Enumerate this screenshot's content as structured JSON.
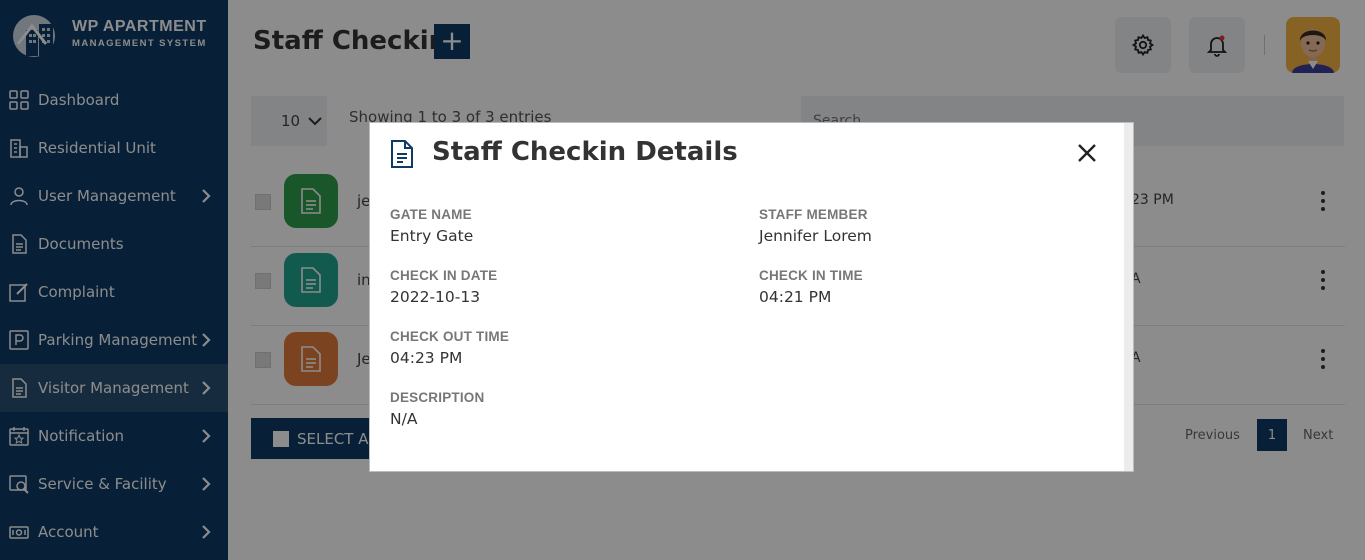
{
  "brand": {
    "title": "WP APARTMENT",
    "subtitle": "MANAGEMENT SYSTEM"
  },
  "sidebar": {
    "items": [
      {
        "label": "Dashboard",
        "icon": "grid-icon",
        "has_submenu": false
      },
      {
        "label": "Residential Unit",
        "icon": "building-icon",
        "has_submenu": false
      },
      {
        "label": "User Management",
        "icon": "user-icon",
        "has_submenu": true
      },
      {
        "label": "Documents",
        "icon": "document-icon",
        "has_submenu": false
      },
      {
        "label": "Complaint",
        "icon": "edit-icon",
        "has_submenu": false
      },
      {
        "label": "Parking Management",
        "icon": "parking-icon",
        "has_submenu": true
      },
      {
        "label": "Visitor Management",
        "icon": "visitor-icon",
        "has_submenu": true,
        "active": true
      },
      {
        "label": "Notification",
        "icon": "calendar-star-icon",
        "has_submenu": true
      },
      {
        "label": "Service & Facility",
        "icon": "service-icon",
        "has_submenu": true
      },
      {
        "label": "Account",
        "icon": "money-icon",
        "has_submenu": true
      }
    ]
  },
  "header": {
    "title": "Staff Checkin",
    "add_label": "+"
  },
  "list": {
    "page_length": "10",
    "showing_text": "Showing 1 to 3 of 3 entries",
    "search_placeholder": "Search",
    "rows": [
      {
        "name_partial": "je",
        "info_partial": "23 PM",
        "icon_color": "#2e9e4f"
      },
      {
        "name_partial": "in",
        "info_partial": "A",
        "icon_color": "#23a48f"
      },
      {
        "name_partial": "Je",
        "info_partial": "A",
        "icon_color": "#e07b3a"
      }
    ],
    "select_all_label": "SELECT AL",
    "pagination": {
      "previous": "Previous",
      "current": "1",
      "next": "Next"
    }
  },
  "modal": {
    "title": "Staff Checkin Details",
    "fields": {
      "gate_name": {
        "label": "GATE NAME",
        "value": "Entry Gate"
      },
      "staff_member": {
        "label": "STAFF MEMBER",
        "value": "Jennifer Lorem"
      },
      "check_in_date": {
        "label": "CHECK IN DATE",
        "value": "2022-10-13"
      },
      "check_in_time": {
        "label": "CHECK IN TIME",
        "value": "04:21 PM"
      },
      "check_out_time": {
        "label": "CHECK OUT TIME",
        "value": "04:23 PM"
      },
      "description": {
        "label": "DESCRIPTION",
        "value": "N/A"
      }
    }
  },
  "colors": {
    "primary": "#0d3b66",
    "active_nav": "#2a4f74",
    "avatar_bg": "#f5b342"
  }
}
